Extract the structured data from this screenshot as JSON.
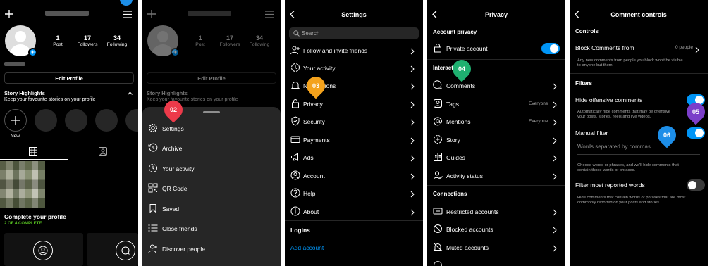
{
  "colors": {
    "background": "#000000",
    "accent": "#0095f6",
    "marker_red": "#ed3a4a",
    "marker_orange": "#f4a21c",
    "marker_green": "#1fb070",
    "marker_purple": "#7b3ec9",
    "marker_blue": "#1d8ee8"
  },
  "profile": {
    "stats": [
      {
        "number": "1",
        "label": "Post"
      },
      {
        "number": "17",
        "label": "Followers"
      },
      {
        "number": "34",
        "label": "Following"
      }
    ],
    "edit_profile": "Edit Profile",
    "highlights_title": "Story Highlights",
    "highlights_subtitle": "Keep your favourite stories on your profile",
    "new_label": "New",
    "complete_title": "Complete your profile",
    "complete_progress": "2 OF 4 COMPLETE",
    "complete_done": 2,
    "complete_total": 4
  },
  "menu": {
    "items": [
      {
        "icon": "settings-gear-icon",
        "label": "Settings"
      },
      {
        "icon": "archive-icon",
        "label": "Archive"
      },
      {
        "icon": "your-activity-icon",
        "label": "Your activity"
      },
      {
        "icon": "qr-code-icon",
        "label": "QR Code"
      },
      {
        "icon": "saved-bookmark-icon",
        "label": "Saved"
      },
      {
        "icon": "close-friends-icon",
        "label": "Close friends"
      },
      {
        "icon": "discover-people-icon",
        "label": "Discover people"
      }
    ]
  },
  "settings": {
    "title": "Settings",
    "search_placeholder": "Search",
    "items": [
      {
        "icon": "follow-invite-icon",
        "label": "Follow and invite friends"
      },
      {
        "icon": "your-activity-icon",
        "label": "Your activity"
      },
      {
        "icon": "bell-icon",
        "label": "Notifications"
      },
      {
        "icon": "lock-icon",
        "label": "Privacy"
      },
      {
        "icon": "shield-icon",
        "label": "Security"
      },
      {
        "icon": "card-icon",
        "label": "Payments"
      },
      {
        "icon": "megaphone-icon",
        "label": "Ads"
      },
      {
        "icon": "account-icon",
        "label": "Account"
      },
      {
        "icon": "help-icon",
        "label": "Help"
      },
      {
        "icon": "info-icon",
        "label": "About"
      }
    ],
    "logins_header": "Logins",
    "add_account": "Add account"
  },
  "privacy": {
    "title": "Privacy",
    "account_privacy_header": "Account privacy",
    "private_account": "Private account",
    "private_account_on": true,
    "interactions_header": "Interactions",
    "interactions": [
      {
        "icon": "comment-icon",
        "label": "Comments",
        "value": ""
      },
      {
        "icon": "tag-icon",
        "label": "Tags",
        "value": "Everyone"
      },
      {
        "icon": "mention-icon",
        "label": "Mentions",
        "value": "Everyone"
      },
      {
        "icon": "story-icon",
        "label": "Story",
        "value": ""
      },
      {
        "icon": "guides-icon",
        "label": "Guides",
        "value": ""
      },
      {
        "icon": "activity-status-icon",
        "label": "Activity status",
        "value": ""
      }
    ],
    "connections_header": "Connections",
    "connections": [
      {
        "icon": "restricted-icon",
        "label": "Restricted accounts"
      },
      {
        "icon": "blocked-icon",
        "label": "Blocked accounts"
      },
      {
        "icon": "muted-icon",
        "label": "Muted accounts"
      }
    ]
  },
  "comment_controls": {
    "title": "Comment controls",
    "controls_header": "Controls",
    "block_from": "Block Comments from",
    "block_value": "0 people",
    "block_desc_1": "Any new comments from people you block won't be visible",
    "block_desc_2": "to anyone but them.",
    "filters_header": "Filters",
    "hide_offensive": "Hide offensive comments",
    "hide_offensive_on": true,
    "hide_desc_1": "Automatically hide comments that may be offensive",
    "hide_desc_2": "your posts, stories, reels and live videos.",
    "manual_filter": "Manual filter",
    "manual_filter_on": true,
    "manual_placeholder": "Words separated by commas...",
    "manual_desc_1": "Choose words or phrases, and we'll hide comments that",
    "manual_desc_2": "contain those words or phrases.",
    "most_reported": "Filter most reported words",
    "most_reported_on": false,
    "reported_desc_1": "Hide comments that contain words or phrases that are most",
    "reported_desc_2": "commonly reported on your posts and stories."
  },
  "markers": [
    "02",
    "03",
    "04",
    "05",
    "06"
  ]
}
